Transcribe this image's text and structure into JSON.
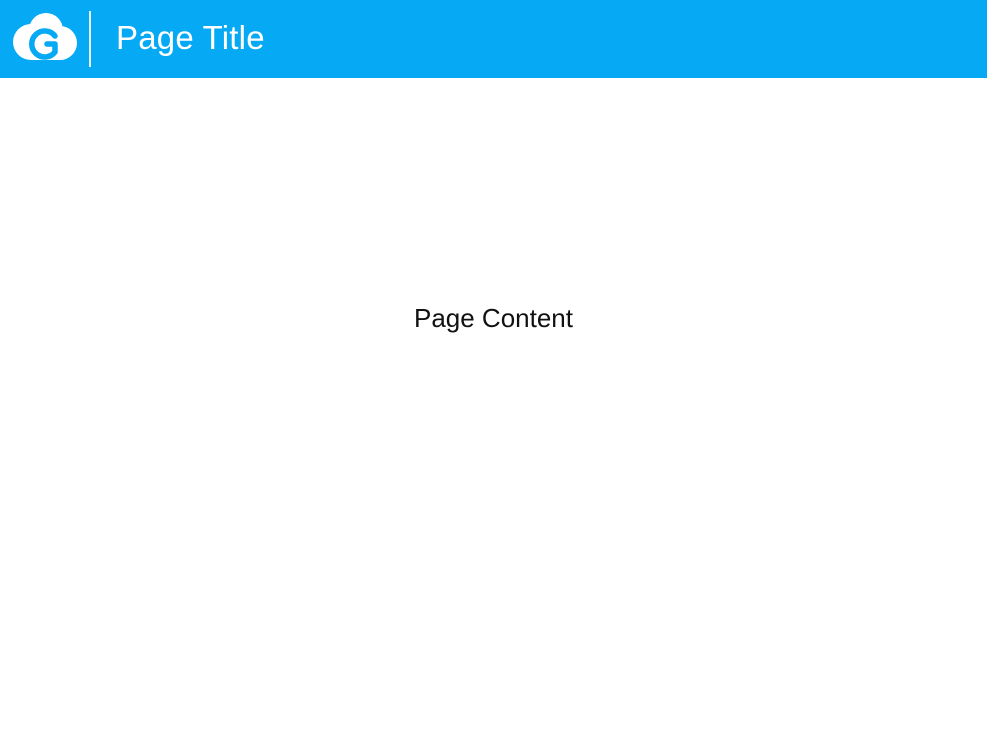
{
  "header": {
    "logo_icon": "cloud-g-logo-icon",
    "title": "Page Title",
    "background_color": "#05a9f4"
  },
  "main": {
    "content_text": "Page Content"
  }
}
